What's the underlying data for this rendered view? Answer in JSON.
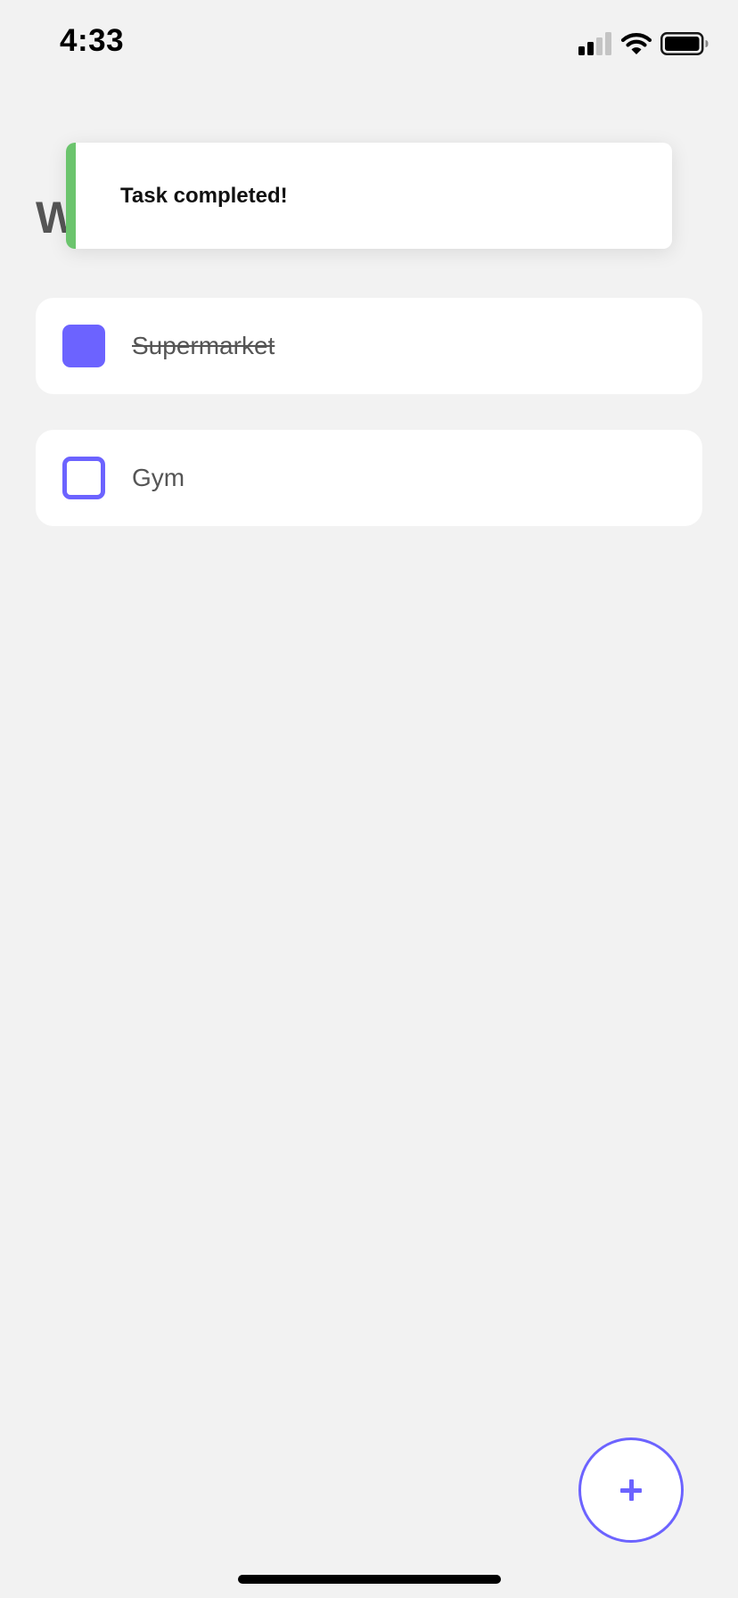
{
  "status_bar": {
    "time": "4:33",
    "icons": [
      "cellular-signal-icon",
      "wifi-icon",
      "battery-icon"
    ]
  },
  "header": {
    "title": "W"
  },
  "toast": {
    "message": "Task completed!",
    "accent_color": "#6bc46d"
  },
  "tasks": [
    {
      "label": "Supermarket",
      "completed": true
    },
    {
      "label": "Gym",
      "completed": false
    }
  ],
  "fab": {
    "icon": "plus-icon"
  },
  "colors": {
    "accent": "#6c63ff",
    "background": "#f2f2f2",
    "card": "#ffffff",
    "text": "#555555"
  }
}
